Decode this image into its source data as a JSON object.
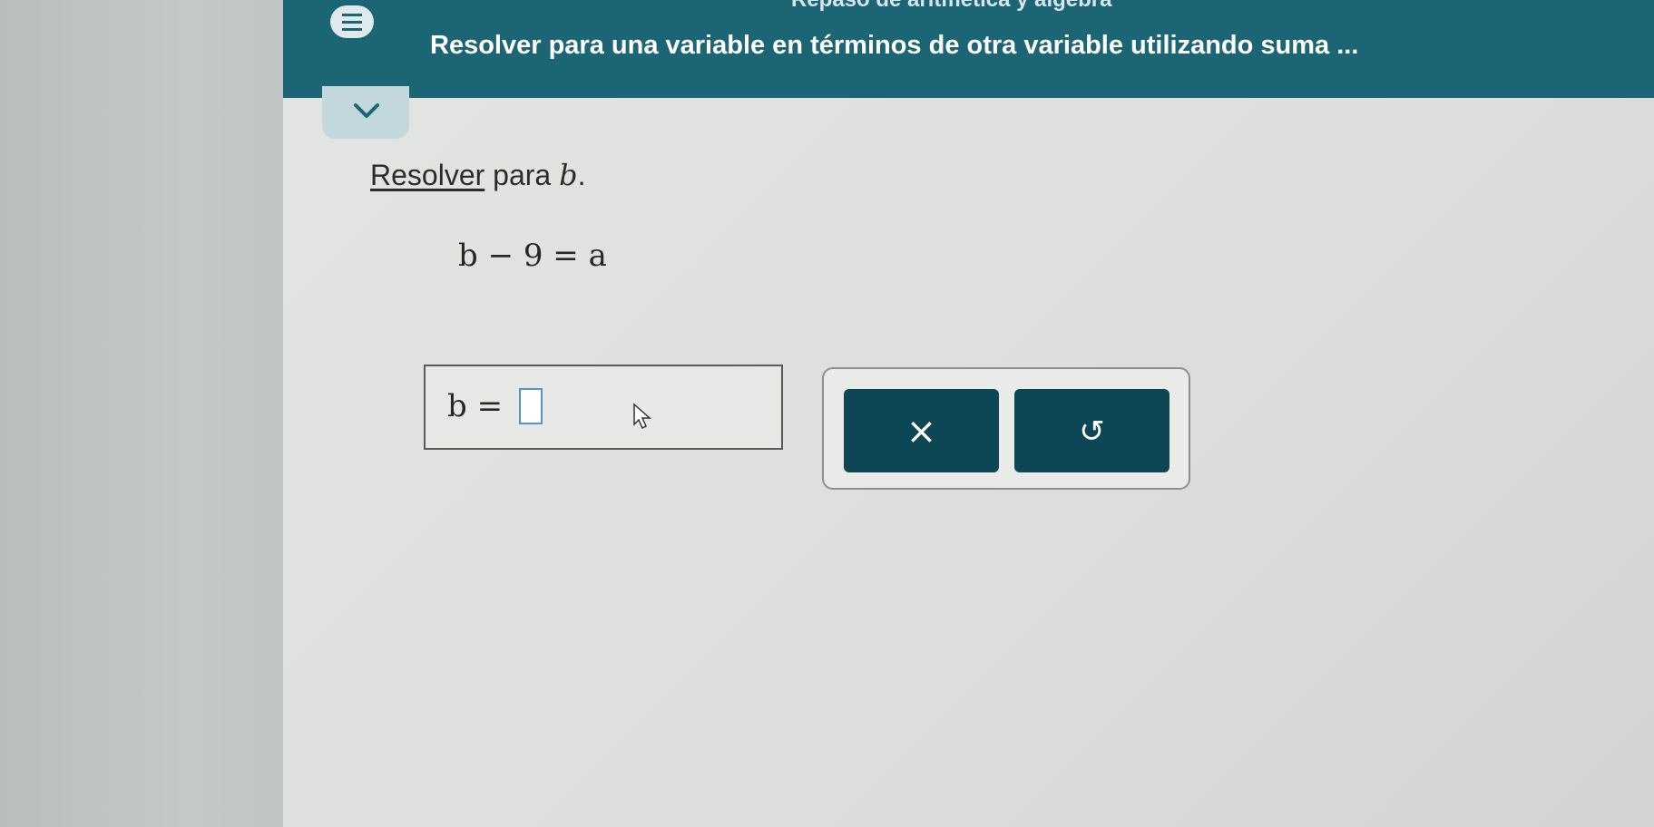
{
  "header": {
    "top_text": "Repaso de aritmética y álgebra",
    "title": "Resolver para una variable en términos de otra variable utilizando suma ..."
  },
  "question": {
    "verb": "Resolver",
    "text": " para ",
    "variable": "b",
    "end": "."
  },
  "equation": "b − 9 = a",
  "answer": {
    "label": "b =",
    "value": ""
  },
  "buttons": {
    "clear_symbol": "×",
    "undo_symbol": "↺"
  },
  "colors": {
    "header": "#1c6575",
    "button": "#0d4756",
    "input_border": "#5a8fd0"
  }
}
